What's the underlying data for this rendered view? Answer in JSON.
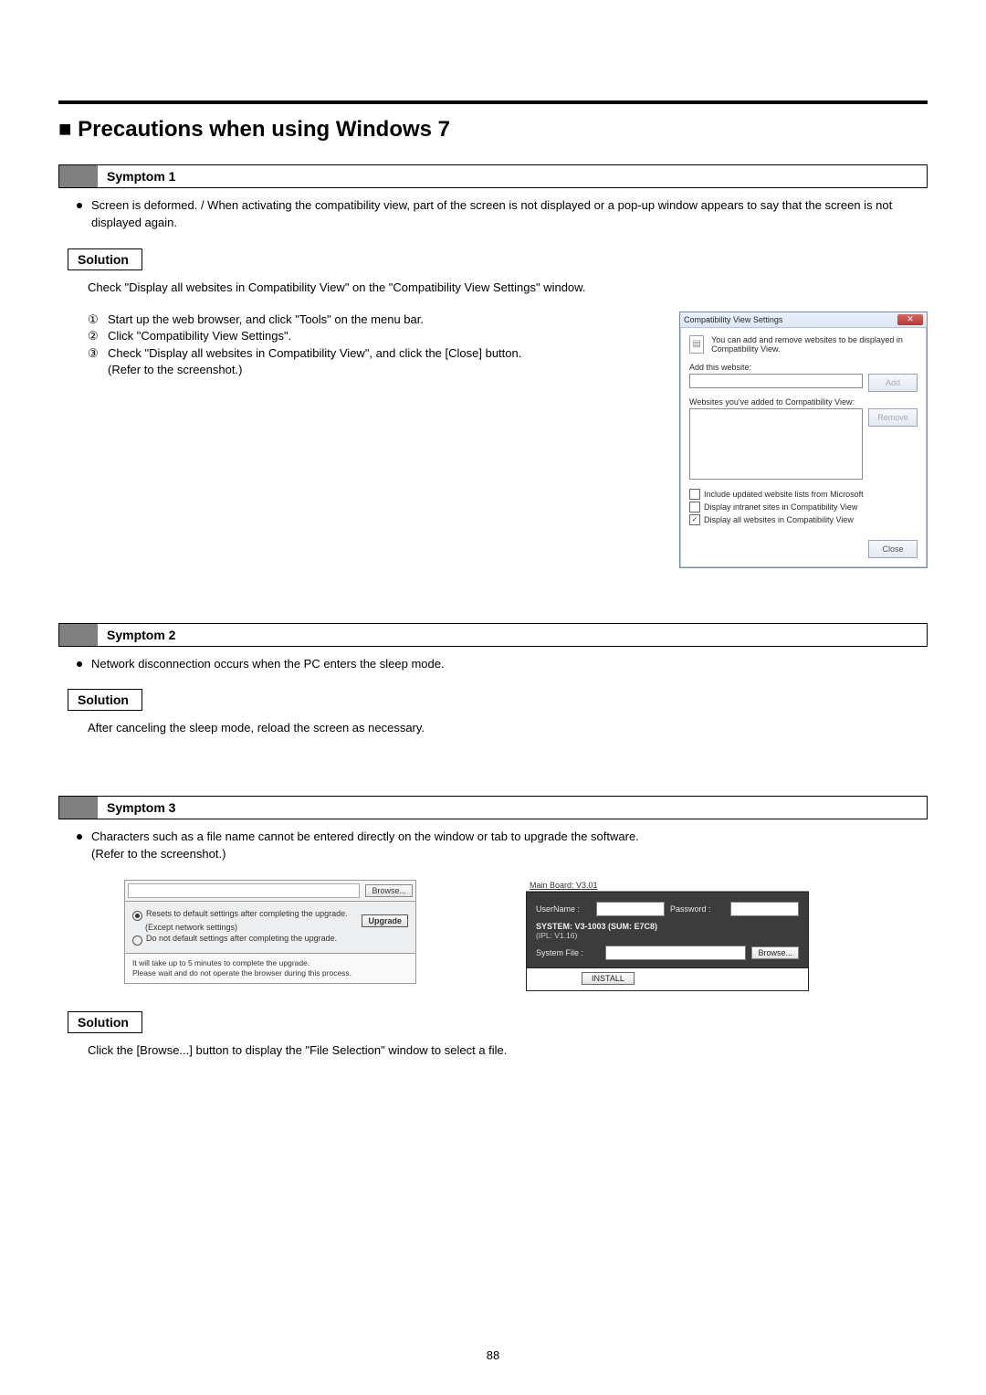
{
  "page_number": "88",
  "title": "Precautions when using Windows 7",
  "symptom1": {
    "header": "Symptom 1",
    "bullet": "Screen is deformed. / When activating the compatibility view, part of the screen is not displayed or a pop-up window appears to say that the screen is not displayed again.",
    "solution_label": "Solution",
    "solution_text": "Check \"Display all websites in Compatibility View\" on the \"Compatibility View Settings\" window.",
    "step1": "Start up the web browser, and click \"Tools\" on the menu bar.",
    "step2": "Click \"Compatibility View Settings\".",
    "step3": "Check \"Display all websites in Compatibility View\", and click the [Close] button.",
    "step3b": "(Refer to the screenshot.)"
  },
  "cv_dialog": {
    "title": "Compatibility View Settings",
    "intro": "You can add and remove websites to be displayed in Compatibility View.",
    "add_label": "Add this website:",
    "add_btn": "Add",
    "list_label": "Websites you've added to Compatibility View:",
    "remove_btn": "Remove",
    "check1": "Include updated website lists from Microsoft",
    "check2": "Display intranet sites in Compatibility View",
    "check3": "Display all websites in Compatibility View",
    "close_btn": "Close"
  },
  "symptom2": {
    "header": "Symptom 2",
    "bullet": "Network disconnection occurs when the PC enters the sleep mode.",
    "solution_label": "Solution",
    "solution_text": "After canceling the sleep mode, reload the screen as necessary."
  },
  "symptom3": {
    "header": "Symptom 3",
    "bullet_a": "Characters such as a file name cannot be entered directly on the window or tab to upgrade the software.",
    "bullet_b": "(Refer to the screenshot.)",
    "solution_label": "Solution",
    "solution_text": "Click the [Browse...] button to display the \"File Selection\" window to select a file."
  },
  "upgrade_panel": {
    "browse": "Browse...",
    "opt1": "Resets to default settings after completing the upgrade.",
    "except": "(Except network settings)",
    "opt2": "Do not default settings after completing the upgrade.",
    "upgrade_btn": "Upgrade",
    "note1": "It will take up to 5 minutes to complete the upgrade.",
    "note2": "Please wait and do not operate the browser during this process."
  },
  "install_panel": {
    "main_board": "Main Board: V3.01",
    "user_label": "UserName :",
    "pass_label": "Password :",
    "sys_line": "SYSTEM: V3-1003 (SUM: E7C8)",
    "ipl": "(IPL: V1.16)",
    "file_label": "System File :",
    "browse": "Browse...",
    "install": "INSTALL"
  }
}
